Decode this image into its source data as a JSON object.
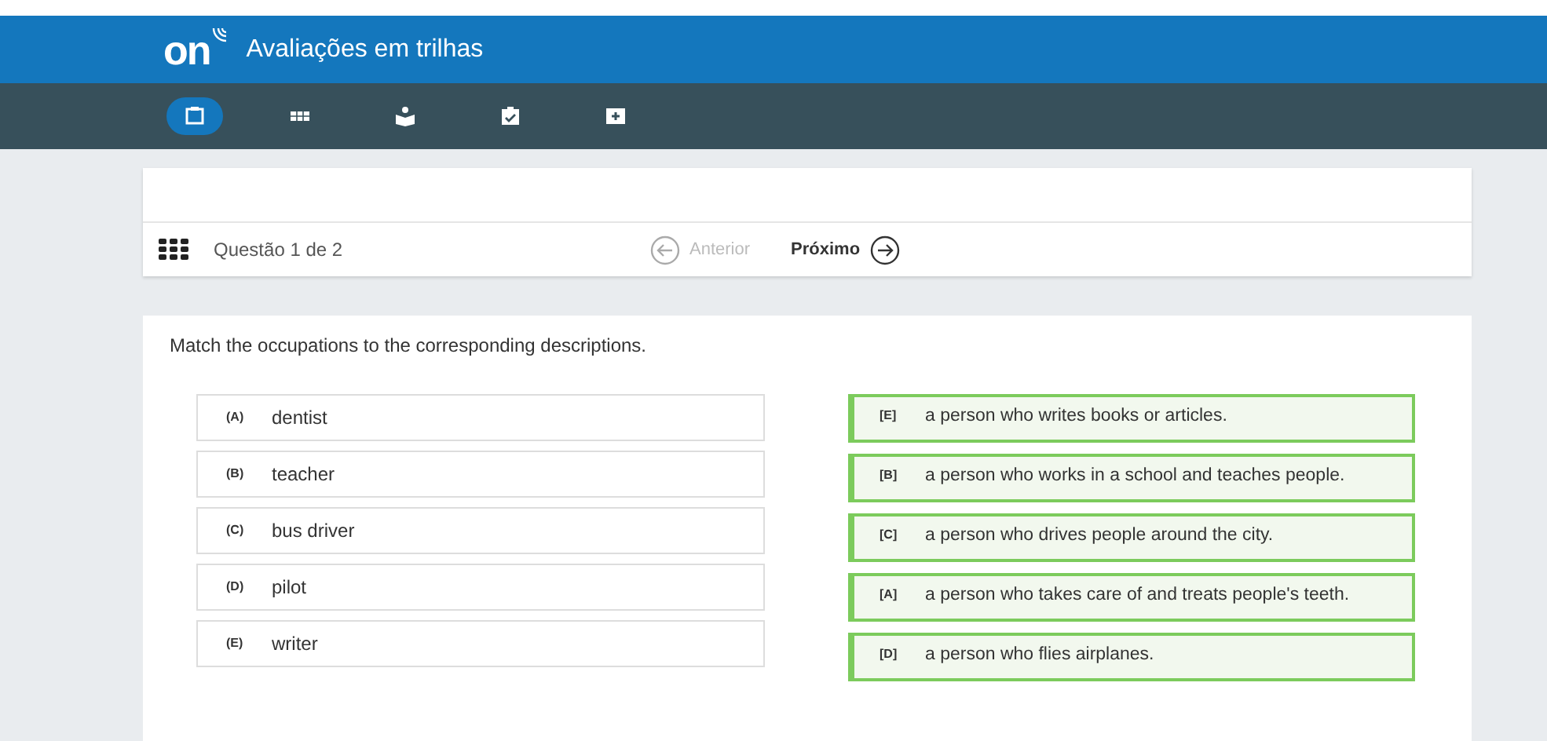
{
  "header": {
    "logo": "on",
    "title": "Avaliações em trilhas"
  },
  "nav_tabs": [
    {
      "kind": "clipboard",
      "selected": true
    },
    {
      "kind": "grid",
      "selected": false
    },
    {
      "kind": "reader",
      "selected": false
    },
    {
      "kind": "check",
      "selected": false
    },
    {
      "kind": "plus",
      "selected": false
    }
  ],
  "question_bar": {
    "counter": "Questão 1 de 2",
    "previous": {
      "label": "Anterior",
      "disabled": true
    },
    "next": {
      "label": "Próximo",
      "disabled": false
    }
  },
  "question": {
    "prompt": "Match the occupations to the corresponding descriptions.",
    "items": [
      {
        "letter": "(A)",
        "text": "dentist"
      },
      {
        "letter": "(B)",
        "text": "teacher"
      },
      {
        "letter": "(C)",
        "text": "bus driver"
      },
      {
        "letter": "(D)",
        "text": "pilot"
      },
      {
        "letter": "(E)",
        "text": "writer"
      }
    ],
    "matches": [
      {
        "letter": "[E]",
        "text": "a person who writes books or articles.",
        "matched": true
      },
      {
        "letter": "[B]",
        "text": "a person who works in a school and teaches people.",
        "matched": true
      },
      {
        "letter": "[C]",
        "text": "a person who drives people around the city.",
        "matched": true
      },
      {
        "letter": "[A]",
        "text": "a person who takes care of and treats people's teeth.",
        "matched": true
      },
      {
        "letter": "[D]",
        "text": "a person who flies airplanes.",
        "matched": true
      }
    ]
  }
}
